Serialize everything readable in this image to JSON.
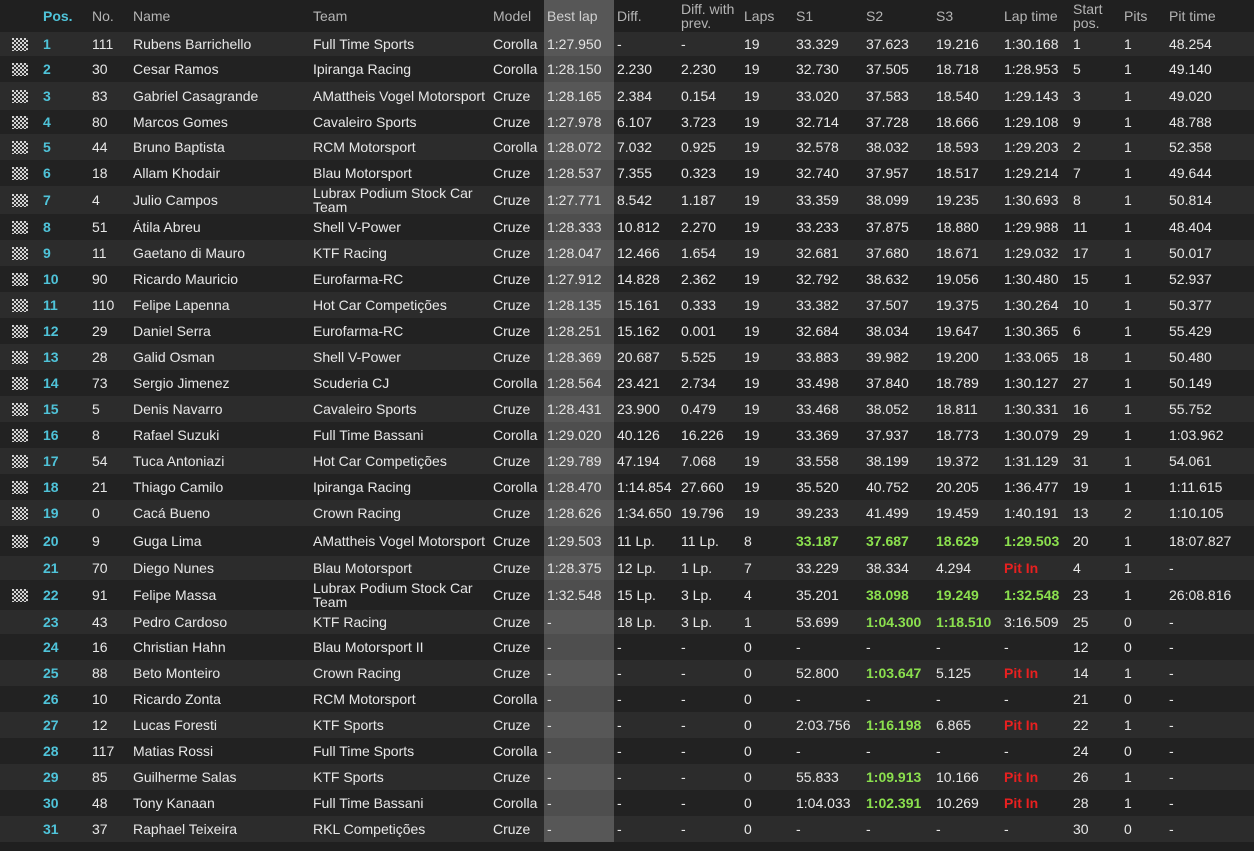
{
  "columns": [
    "Pos.",
    "No.",
    "Name",
    "Team",
    "Model",
    "Best lap",
    "Diff.",
    "Diff. with prev.",
    "Laps",
    "S1",
    "S2",
    "S3",
    "Lap time",
    "Start pos.",
    "Pits",
    "Pit time"
  ],
  "colors": {
    "pos": "#4fc3d9",
    "green": "#8be04e",
    "red": "#e82020",
    "best_col": "#575757"
  },
  "rows": [
    {
      "flag": true,
      "pos": "1",
      "no": "111",
      "name": "Rubens Barrichello",
      "team": "Full Time Sports",
      "model": "Corolla",
      "best": "1:27.950",
      "diff": "-",
      "prev": "-",
      "laps": "19",
      "s1": "33.329",
      "s2": "37.623",
      "s3": "19.216",
      "lap": "1:30.168",
      "start": "1",
      "pits": "1",
      "pit_time": "48.254"
    },
    {
      "flag": true,
      "pos": "2",
      "no": "30",
      "name": "Cesar Ramos",
      "team": "Ipiranga Racing",
      "model": "Corolla",
      "best": "1:28.150",
      "diff": "2.230",
      "prev": "2.230",
      "laps": "19",
      "s1": "32.730",
      "s2": "37.505",
      "s3": "18.718",
      "lap": "1:28.953",
      "start": "5",
      "pits": "1",
      "pit_time": "49.140"
    },
    {
      "flag": true,
      "pos": "3",
      "no": "83",
      "name": "Gabriel Casagrande",
      "team": "AMattheis Vogel Motorsport",
      "model": "Cruze",
      "best": "1:28.165",
      "diff": "2.384",
      "prev": "0.154",
      "laps": "19",
      "s1": "33.020",
      "s2": "37.583",
      "s3": "18.540",
      "lap": "1:29.143",
      "start": "3",
      "pits": "1",
      "pit_time": "49.020"
    },
    {
      "flag": true,
      "pos": "4",
      "no": "80",
      "name": "Marcos Gomes",
      "team": "Cavaleiro Sports",
      "model": "Cruze",
      "best": "1:27.978",
      "diff": "6.107",
      "prev": "3.723",
      "laps": "19",
      "s1": "32.714",
      "s2": "37.728",
      "s3": "18.666",
      "lap": "1:29.108",
      "start": "9",
      "pits": "1",
      "pit_time": "48.788"
    },
    {
      "flag": true,
      "pos": "5",
      "no": "44",
      "name": "Bruno Baptista",
      "team": "RCM Motorsport",
      "model": "Corolla",
      "best": "1:28.072",
      "diff": "7.032",
      "prev": "0.925",
      "laps": "19",
      "s1": "32.578",
      "s2": "38.032",
      "s3": "18.593",
      "lap": "1:29.203",
      "start": "2",
      "pits": "1",
      "pit_time": "52.358"
    },
    {
      "flag": true,
      "pos": "6",
      "no": "18",
      "name": "Allam Khodair",
      "team": "Blau Motorsport",
      "model": "Cruze",
      "best": "1:28.537",
      "diff": "7.355",
      "prev": "0.323",
      "laps": "19",
      "s1": "32.740",
      "s2": "37.957",
      "s3": "18.517",
      "lap": "1:29.214",
      "start": "7",
      "pits": "1",
      "pit_time": "49.644"
    },
    {
      "flag": true,
      "pos": "7",
      "no": "4",
      "name": "Julio Campos",
      "team": "Lubrax Podium Stock Car Team",
      "model": "Cruze",
      "best": "1:27.771",
      "diff": "8.542",
      "prev": "1.187",
      "laps": "19",
      "s1": "33.359",
      "s2": "38.099",
      "s3": "19.235",
      "lap": "1:30.693",
      "start": "8",
      "pits": "1",
      "pit_time": "50.814"
    },
    {
      "flag": true,
      "pos": "8",
      "no": "51",
      "name": "Átila Abreu",
      "team": "Shell V-Power",
      "model": "Cruze",
      "best": "1:28.333",
      "diff": "10.812",
      "prev": "2.270",
      "laps": "19",
      "s1": "33.233",
      "s2": "37.875",
      "s3": "18.880",
      "lap": "1:29.988",
      "start": "11",
      "pits": "1",
      "pit_time": "48.404"
    },
    {
      "flag": true,
      "pos": "9",
      "no": "11",
      "name": "Gaetano di Mauro",
      "team": "KTF Racing",
      "model": "Cruze",
      "best": "1:28.047",
      "diff": "12.466",
      "prev": "1.654",
      "laps": "19",
      "s1": "32.681",
      "s2": "37.680",
      "s3": "18.671",
      "lap": "1:29.032",
      "start": "17",
      "pits": "1",
      "pit_time": "50.017"
    },
    {
      "flag": true,
      "pos": "10",
      "no": "90",
      "name": "Ricardo Mauricio",
      "team": "Eurofarma-RC",
      "model": "Cruze",
      "best": "1:27.912",
      "diff": "14.828",
      "prev": "2.362",
      "laps": "19",
      "s1": "32.792",
      "s2": "38.632",
      "s3": "19.056",
      "lap": "1:30.480",
      "start": "15",
      "pits": "1",
      "pit_time": "52.937"
    },
    {
      "flag": true,
      "pos": "11",
      "no": "110",
      "name": "Felipe Lapenna",
      "team": "Hot Car Competições",
      "model": "Cruze",
      "best": "1:28.135",
      "diff": "15.161",
      "prev": "0.333",
      "laps": "19",
      "s1": "33.382",
      "s2": "37.507",
      "s3": "19.375",
      "lap": "1:30.264",
      "start": "10",
      "pits": "1",
      "pit_time": "50.377"
    },
    {
      "flag": true,
      "pos": "12",
      "no": "29",
      "name": "Daniel Serra",
      "team": "Eurofarma-RC",
      "model": "Cruze",
      "best": "1:28.251",
      "diff": "15.162",
      "prev": "0.001",
      "laps": "19",
      "s1": "32.684",
      "s2": "38.034",
      "s3": "19.647",
      "lap": "1:30.365",
      "start": "6",
      "pits": "1",
      "pit_time": "55.429"
    },
    {
      "flag": true,
      "pos": "13",
      "no": "28",
      "name": "Galid Osman",
      "team": "Shell V-Power",
      "model": "Cruze",
      "best": "1:28.369",
      "diff": "20.687",
      "prev": "5.525",
      "laps": "19",
      "s1": "33.883",
      "s2": "39.982",
      "s3": "19.200",
      "lap": "1:33.065",
      "start": "18",
      "pits": "1",
      "pit_time": "50.480"
    },
    {
      "flag": true,
      "pos": "14",
      "no": "73",
      "name": "Sergio Jimenez",
      "team": "Scuderia CJ",
      "model": "Corolla",
      "best": "1:28.564",
      "diff": "23.421",
      "prev": "2.734",
      "laps": "19",
      "s1": "33.498",
      "s2": "37.840",
      "s3": "18.789",
      "lap": "1:30.127",
      "start": "27",
      "pits": "1",
      "pit_time": "50.149"
    },
    {
      "flag": true,
      "pos": "15",
      "no": "5",
      "name": "Denis Navarro",
      "team": "Cavaleiro Sports",
      "model": "Cruze",
      "best": "1:28.431",
      "diff": "23.900",
      "prev": "0.479",
      "laps": "19",
      "s1": "33.468",
      "s2": "38.052",
      "s3": "18.811",
      "lap": "1:30.331",
      "start": "16",
      "pits": "1",
      "pit_time": "55.752"
    },
    {
      "flag": true,
      "pos": "16",
      "no": "8",
      "name": "Rafael Suzuki",
      "team": "Full Time Bassani",
      "model": "Corolla",
      "best": "1:29.020",
      "diff": "40.126",
      "prev": "16.226",
      "laps": "19",
      "s1": "33.369",
      "s2": "37.937",
      "s3": "18.773",
      "lap": "1:30.079",
      "start": "29",
      "pits": "1",
      "pit_time": "1:03.962"
    },
    {
      "flag": true,
      "pos": "17",
      "no": "54",
      "name": "Tuca Antoniazi",
      "team": "Hot Car Competições",
      "model": "Cruze",
      "best": "1:29.789",
      "diff": "47.194",
      "prev": "7.068",
      "laps": "19",
      "s1": "33.558",
      "s2": "38.199",
      "s3": "19.372",
      "lap": "1:31.129",
      "start": "31",
      "pits": "1",
      "pit_time": "54.061"
    },
    {
      "flag": true,
      "pos": "18",
      "no": "21",
      "name": "Thiago Camilo",
      "team": "Ipiranga Racing",
      "model": "Corolla",
      "best": "1:28.470",
      "diff": "1:14.854",
      "prev": "27.660",
      "laps": "19",
      "s1": "35.520",
      "s2": "40.752",
      "s3": "20.205",
      "lap": "1:36.477",
      "start": "19",
      "pits": "1",
      "pit_time": "1:11.615"
    },
    {
      "flag": true,
      "pos": "19",
      "no": "0",
      "name": "Cacá Bueno",
      "team": "Crown Racing",
      "model": "Cruze",
      "best": "1:28.626",
      "diff": "1:34.650",
      "prev": "19.796",
      "laps": "19",
      "s1": "39.233",
      "s2": "41.499",
      "s3": "19.459",
      "lap": "1:40.191",
      "start": "13",
      "pits": "2",
      "pit_time": "1:10.105"
    },
    {
      "flag": true,
      "pos": "20",
      "no": "9",
      "name": "Guga Lima",
      "team": "AMattheis Vogel Motorsport",
      "model": "Cruze",
      "best": "1:29.503",
      "diff": "11 Lp.",
      "prev": "11 Lp.",
      "laps": "8",
      "s1": "33.187",
      "s2": "37.687",
      "s3": "18.629",
      "lap": "1:29.503",
      "start": "20",
      "pits": "1",
      "pit_time": "18:07.827",
      "s1_c": "green",
      "s2_c": "green",
      "s3_c": "green",
      "lap_c": "green"
    },
    {
      "flag": false,
      "pos": "21",
      "no": "70",
      "name": "Diego Nunes",
      "team": "Blau Motorsport",
      "model": "Cruze",
      "best": "1:28.375",
      "diff": "12 Lp.",
      "prev": "1 Lp.",
      "laps": "7",
      "s1": "33.229",
      "s2": "38.334",
      "s3": "4.294",
      "lap": "Pit In",
      "start": "4",
      "pits": "1",
      "pit_time": "-",
      "lap_c": "red"
    },
    {
      "flag": true,
      "pos": "22",
      "no": "91",
      "name": "Felipe Massa",
      "team": "Lubrax Podium Stock Car Team",
      "model": "Cruze",
      "best": "1:32.548",
      "diff": "15 Lp.",
      "prev": "3 Lp.",
      "laps": "4",
      "s1": "35.201",
      "s2": "38.098",
      "s3": "19.249",
      "lap": "1:32.548",
      "start": "23",
      "pits": "1",
      "pit_time": "26:08.816",
      "s2_c": "green",
      "s3_c": "green",
      "lap_c": "green"
    },
    {
      "flag": false,
      "pos": "23",
      "no": "43",
      "name": "Pedro Cardoso",
      "team": "KTF Racing",
      "model": "Cruze",
      "best": "-",
      "diff": "18 Lp.",
      "prev": "3 Lp.",
      "laps": "1",
      "s1": "53.699",
      "s2": "1:04.300",
      "s3": "1:18.510",
      "lap": "3:16.509",
      "start": "25",
      "pits": "0",
      "pit_time": "-",
      "s2_c": "green",
      "s3_c": "green"
    },
    {
      "flag": false,
      "pos": "24",
      "no": "16",
      "name": "Christian Hahn",
      "team": "Blau Motorsport II",
      "model": "Cruze",
      "best": "-",
      "diff": "-",
      "prev": "-",
      "laps": "0",
      "s1": "-",
      "s2": "-",
      "s3": "-",
      "lap": "-",
      "start": "12",
      "pits": "0",
      "pit_time": "-"
    },
    {
      "flag": false,
      "pos": "25",
      "no": "88",
      "name": "Beto Monteiro",
      "team": "Crown Racing",
      "model": "Cruze",
      "best": "-",
      "diff": "-",
      "prev": "-",
      "laps": "0",
      "s1": "52.800",
      "s2": "1:03.647",
      "s3": "5.125",
      "lap": "Pit In",
      "start": "14",
      "pits": "1",
      "pit_time": "-",
      "s2_c": "green",
      "lap_c": "red"
    },
    {
      "flag": false,
      "pos": "26",
      "no": "10",
      "name": "Ricardo Zonta",
      "team": "RCM Motorsport",
      "model": "Corolla",
      "best": "-",
      "diff": "-",
      "prev": "-",
      "laps": "0",
      "s1": "-",
      "s2": "-",
      "s3": "-",
      "lap": "-",
      "start": "21",
      "pits": "0",
      "pit_time": "-"
    },
    {
      "flag": false,
      "pos": "27",
      "no": "12",
      "name": "Lucas Foresti",
      "team": "KTF Sports",
      "model": "Cruze",
      "best": "-",
      "diff": "-",
      "prev": "-",
      "laps": "0",
      "s1": "2:03.756",
      "s2": "1:16.198",
      "s3": "6.865",
      "lap": "Pit In",
      "start": "22",
      "pits": "1",
      "pit_time": "-",
      "s2_c": "green",
      "lap_c": "red"
    },
    {
      "flag": false,
      "pos": "28",
      "no": "117",
      "name": "Matias Rossi",
      "team": "Full Time Sports",
      "model": "Corolla",
      "best": "-",
      "diff": "-",
      "prev": "-",
      "laps": "0",
      "s1": "-",
      "s2": "-",
      "s3": "-",
      "lap": "-",
      "start": "24",
      "pits": "0",
      "pit_time": "-"
    },
    {
      "flag": false,
      "pos": "29",
      "no": "85",
      "name": "Guilherme Salas",
      "team": "KTF Sports",
      "model": "Cruze",
      "best": "-",
      "diff": "-",
      "prev": "-",
      "laps": "0",
      "s1": "55.833",
      "s2": "1:09.913",
      "s3": "10.166",
      "lap": "Pit In",
      "start": "26",
      "pits": "1",
      "pit_time": "-",
      "s2_c": "green",
      "lap_c": "red"
    },
    {
      "flag": false,
      "pos": "30",
      "no": "48",
      "name": "Tony Kanaan",
      "team": "Full Time Bassani",
      "model": "Corolla",
      "best": "-",
      "diff": "-",
      "prev": "-",
      "laps": "0",
      "s1": "1:04.033",
      "s2": "1:02.391",
      "s3": "10.269",
      "lap": "Pit In",
      "start": "28",
      "pits": "1",
      "pit_time": "-",
      "s2_c": "green",
      "lap_c": "red"
    },
    {
      "flag": false,
      "pos": "31",
      "no": "37",
      "name": "Raphael Teixeira",
      "team": "RKL Competições",
      "model": "Cruze",
      "best": "-",
      "diff": "-",
      "prev": "-",
      "laps": "0",
      "s1": "-",
      "s2": "-",
      "s3": "-",
      "lap": "-",
      "start": "30",
      "pits": "0",
      "pit_time": "-"
    }
  ]
}
